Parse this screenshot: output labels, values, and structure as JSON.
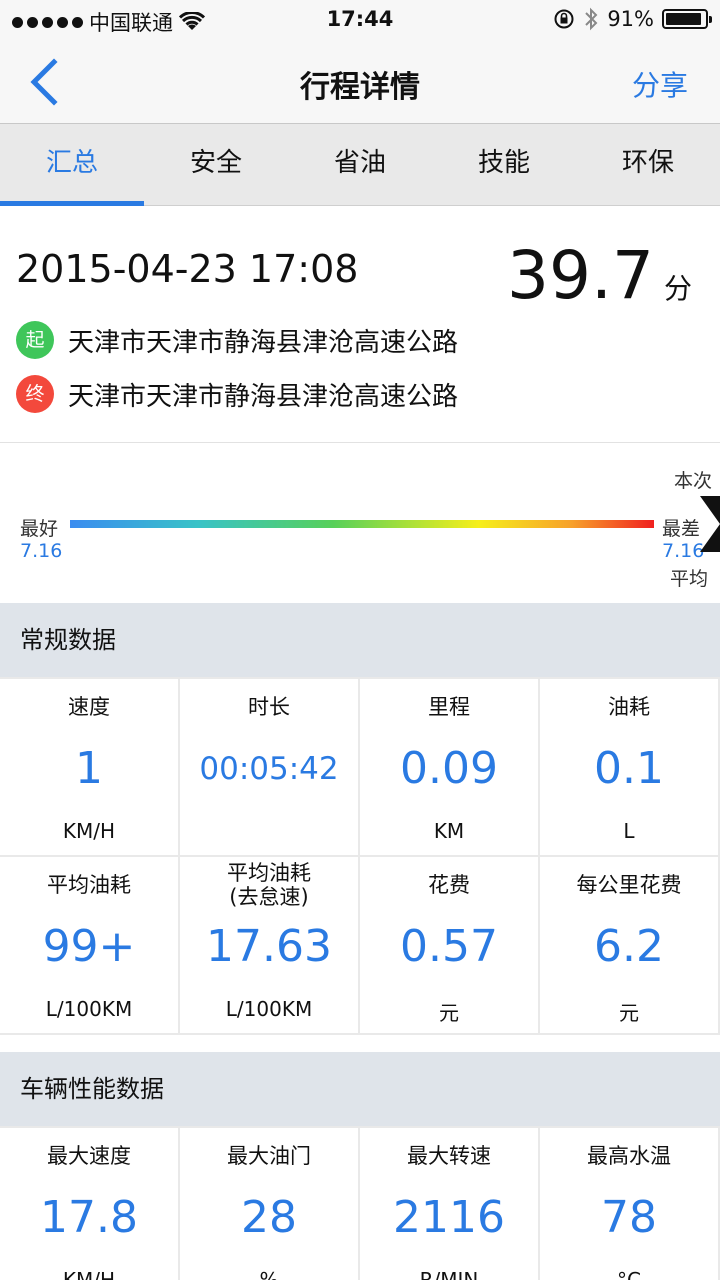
{
  "status_bar": {
    "carrier": "中国联通",
    "time": "17:44",
    "battery": "91%",
    "battery_level": 0.91
  },
  "nav": {
    "title": "行程详情",
    "share": "分享"
  },
  "tabs": [
    "汇总",
    "安全",
    "省油",
    "技能",
    "环保"
  ],
  "trip": {
    "datetime": "2015-04-23 17:08",
    "score": "39.7",
    "score_unit": "分",
    "start_badge": "起",
    "end_badge": "终",
    "start": "天津市天津市静海县津沧高速公路",
    "end": "天津市天津市静海县津沧高速公路"
  },
  "scale": {
    "best_label": "最好",
    "best_value": "7.16",
    "worst_label": "最差",
    "worst_value": "7.16",
    "current_label": "本次",
    "average_label": "平均"
  },
  "general": {
    "title": "常规数据",
    "cells": [
      {
        "label": "速度",
        "value": "1",
        "unit": "KM/H"
      },
      {
        "label": "时长",
        "value": "00:05:42",
        "unit": ""
      },
      {
        "label": "里程",
        "value": "0.09",
        "unit": "KM"
      },
      {
        "label": "油耗",
        "value": "0.1",
        "unit": "L"
      },
      {
        "label": "平均油耗",
        "value": "99+",
        "unit": "L/100KM"
      },
      {
        "label": "平均油耗\n(去怠速)",
        "value": "17.63",
        "unit": "L/100KM"
      },
      {
        "label": "花费",
        "value": "0.57",
        "unit": "元"
      },
      {
        "label": "每公里花费",
        "value": "6.2",
        "unit": "元"
      }
    ]
  },
  "vehicle": {
    "title": "车辆性能数据",
    "cells": [
      {
        "label": "最大速度",
        "value": "17.8",
        "unit": "KM/H"
      },
      {
        "label": "最大油门",
        "value": "28",
        "unit": "%"
      },
      {
        "label": "最大转速",
        "value": "2116",
        "unit": "R/MIN"
      },
      {
        "label": "最高水温",
        "value": "78",
        "unit": "°C"
      }
    ]
  }
}
